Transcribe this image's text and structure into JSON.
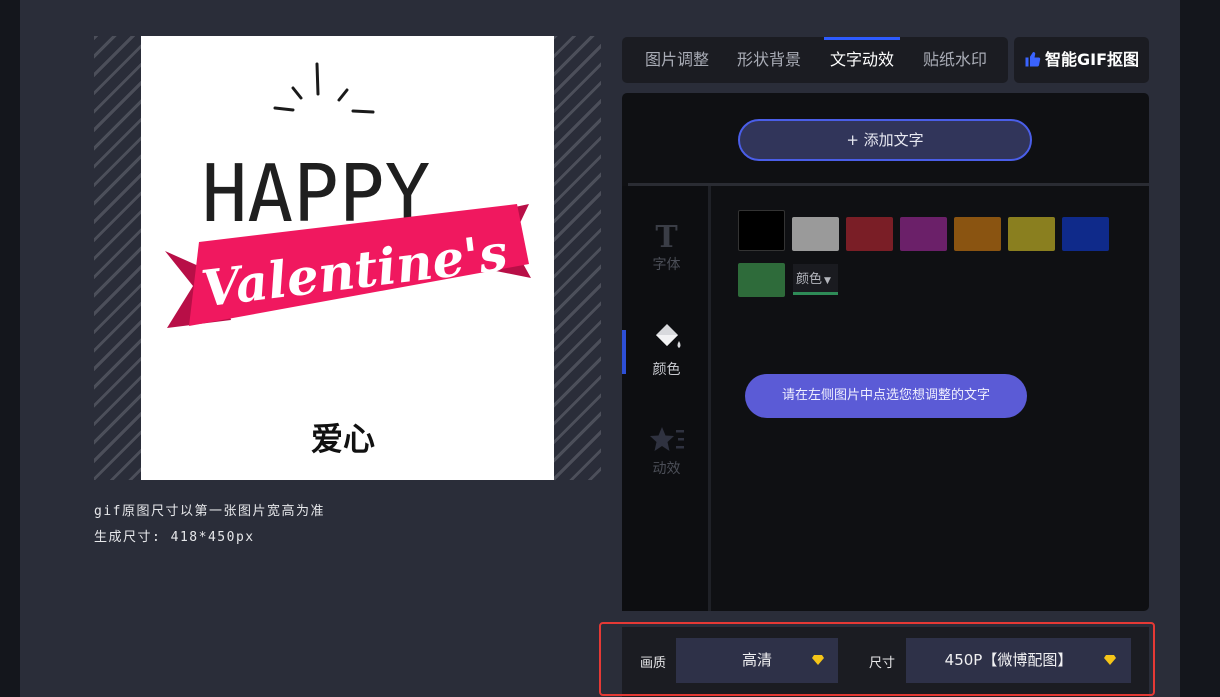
{
  "preview": {
    "image_text": [
      "HAPPY",
      "Valentine's",
      "爱心"
    ],
    "caption_line1": "gif原图尺寸以第一张图片宽高为准",
    "caption_line2": "生成尺寸: 418*450px"
  },
  "tabs": [
    {
      "label": "图片调整",
      "active": false
    },
    {
      "label": "形状背景",
      "active": false
    },
    {
      "label": "文字动效",
      "active": true
    },
    {
      "label": "贴纸水印",
      "active": false
    }
  ],
  "smart_gif_button": {
    "label": "智能GIF抠图",
    "icon": "thumbs-up-icon"
  },
  "add_text_button": "+ 添加文字",
  "side_menu": [
    {
      "label": "字体",
      "icon": "T",
      "active": false
    },
    {
      "label": "颜色",
      "icon": "paint-bucket-icon",
      "active": true
    },
    {
      "label": "动效",
      "icon": "star-icon",
      "active": false
    }
  ],
  "swatches": [
    "#000000",
    "#9a9a9a",
    "#7a1e26",
    "#6b2069",
    "#8a5411",
    "#8a7f1f",
    "#0f2a8a",
    "#2e6b3a"
  ],
  "color_dropdown_label": "颜色",
  "hint_text": "请在左侧图片中点选您想调整的文字",
  "bottom": {
    "quality_label": "画质",
    "quality_value": "高清",
    "size_label": "尺寸",
    "size_value": "450P【微博配图】"
  },
  "colors": {
    "accent": "#2d5bff",
    "banner": "#f0185f",
    "highlight_border": "#e53935",
    "gem": "#f5c518"
  }
}
